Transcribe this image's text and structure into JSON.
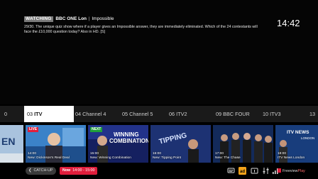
{
  "info": {
    "watching_badge": "WATCHING",
    "channel": "BBC ONE Lon",
    "separator": "|",
    "programme": "Impossible",
    "synopsis": "29/30. The unique quiz show where if a player gives an Impossible answer, they are immediately eliminated. Which of the 24 contestants will face the £10,000 question today? Also in HD. [S]",
    "clock": "14:42"
  },
  "channels": [
    {
      "number": "",
      "name": "0",
      "selected": false
    },
    {
      "number": "03",
      "name": "ITV",
      "selected": true
    },
    {
      "number": "04",
      "name": "Channel 4",
      "selected": false
    },
    {
      "number": "05",
      "name": "Channel 5",
      "selected": false
    },
    {
      "number": "06",
      "name": "ITV2",
      "selected": false
    },
    {
      "number": "09",
      "name": "BBC FOUR",
      "selected": false
    },
    {
      "number": "10",
      "name": "ITV3",
      "selected": false
    },
    {
      "number": "",
      "name": "13",
      "selected": false
    }
  ],
  "tiles": [
    {
      "badge": "",
      "time": "",
      "title": ""
    },
    {
      "badge": "LIVE",
      "time": "14:00",
      "title": "New: Dickinson's Real Deal"
    },
    {
      "badge": "NEXT",
      "time": "15:00",
      "title": "New: Winning Combination"
    },
    {
      "badge": "",
      "time": "16:00",
      "title": "New: Tipping Point"
    },
    {
      "badge": "",
      "time": "17:00",
      "title": "New: The Chase"
    },
    {
      "badge": "",
      "time": "18:00",
      "title": "ITV News London"
    }
  ],
  "tile_art": {
    "winning_text_1": "WINNING",
    "winning_text_2": "COMBINATION",
    "tipping_text": "TIPPING",
    "itv_logo": "ITV NEWS",
    "london": "LONDON"
  },
  "bottom": {
    "catchup_label": "CATCH-UP",
    "now_label": "Now",
    "now_time": "14:00 - 15:00",
    "brand": "Freeview",
    "brand_suffix": "Play"
  },
  "colors": {
    "accent": "#e01e3c",
    "next": "#1f9e3a",
    "channel_bar": "#1a1a1a"
  }
}
